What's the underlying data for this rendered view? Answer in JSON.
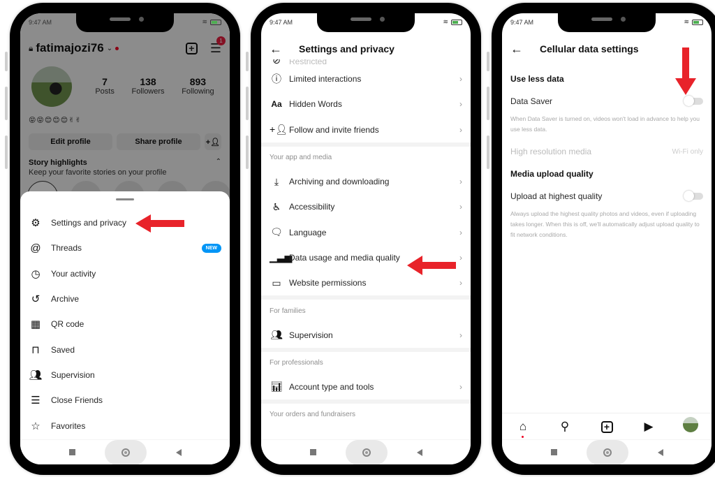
{
  "status_bar": {
    "time": "9:47 AM"
  },
  "screen1": {
    "username": "fatimajozi76",
    "notification_count": "1",
    "stats": [
      {
        "value": "7",
        "label": "Posts"
      },
      {
        "value": "138",
        "label": "Followers"
      },
      {
        "value": "893",
        "label": "Following"
      }
    ],
    "bio": "😝😝😊😊😊✌✌",
    "buttons": {
      "edit": "Edit profile",
      "share": "Share profile"
    },
    "highlights": {
      "title": "Story highlights",
      "subtitle": "Keep your favorite stories on your profile"
    },
    "menu": [
      {
        "label": "Settings and privacy",
        "icon": "gear-icon"
      },
      {
        "label": "Threads",
        "icon": "threads-icon",
        "badge": "NEW"
      },
      {
        "label": "Your activity",
        "icon": "activity-icon"
      },
      {
        "label": "Archive",
        "icon": "archive-icon"
      },
      {
        "label": "QR code",
        "icon": "qr-code-icon"
      },
      {
        "label": "Saved",
        "icon": "bookmark-icon"
      },
      {
        "label": "Supervision",
        "icon": "supervision-icon"
      },
      {
        "label": "Close Friends",
        "icon": "close-friends-icon"
      },
      {
        "label": "Favorites",
        "icon": "star-icon"
      }
    ]
  },
  "screen2": {
    "title": "Settings and privacy",
    "partial_row": "Restricted",
    "rows_top": [
      {
        "label": "Limited interactions",
        "icon": "limited-interactions-icon"
      },
      {
        "label": "Hidden Words",
        "icon": "hidden-words-icon"
      },
      {
        "label": "Follow and invite friends",
        "icon": "add-person-icon"
      }
    ],
    "section_app": "Your app and media",
    "rows_app": [
      {
        "label": "Archiving and downloading",
        "icon": "download-icon"
      },
      {
        "label": "Accessibility",
        "icon": "accessibility-icon"
      },
      {
        "label": "Language",
        "icon": "language-icon"
      },
      {
        "label": "Data usage and media quality",
        "icon": "signal-icon"
      },
      {
        "label": "Website permissions",
        "icon": "devices-icon"
      }
    ],
    "section_families": "For families",
    "rows_families": [
      {
        "label": "Supervision",
        "icon": "supervision-icon"
      }
    ],
    "section_professionals": "For professionals",
    "rows_professionals": [
      {
        "label": "Account type and tools",
        "icon": "chart-icon"
      }
    ],
    "section_orders": "Your orders and fundraisers"
  },
  "screen3": {
    "title": "Cellular data settings",
    "section_less_data": "Use less data",
    "data_saver": {
      "label": "Data Saver",
      "enabled": false
    },
    "data_saver_desc": "When Data Saver is turned on, videos won't load in advance to help you use less data.",
    "high_res": {
      "label": "High resolution media",
      "value": "Wi-Fi only"
    },
    "section_upload": "Media upload quality",
    "upload_highest": {
      "label": "Upload at highest quality",
      "enabled": false
    },
    "upload_desc": "Always upload the highest quality photos and videos, even if uploading takes longer. When this is off, we'll automatically adjust upload quality to fit network conditions."
  },
  "colors": {
    "arrow": "#e8232a",
    "new_badge": "#0095f6",
    "notification": "#e41e3f"
  }
}
